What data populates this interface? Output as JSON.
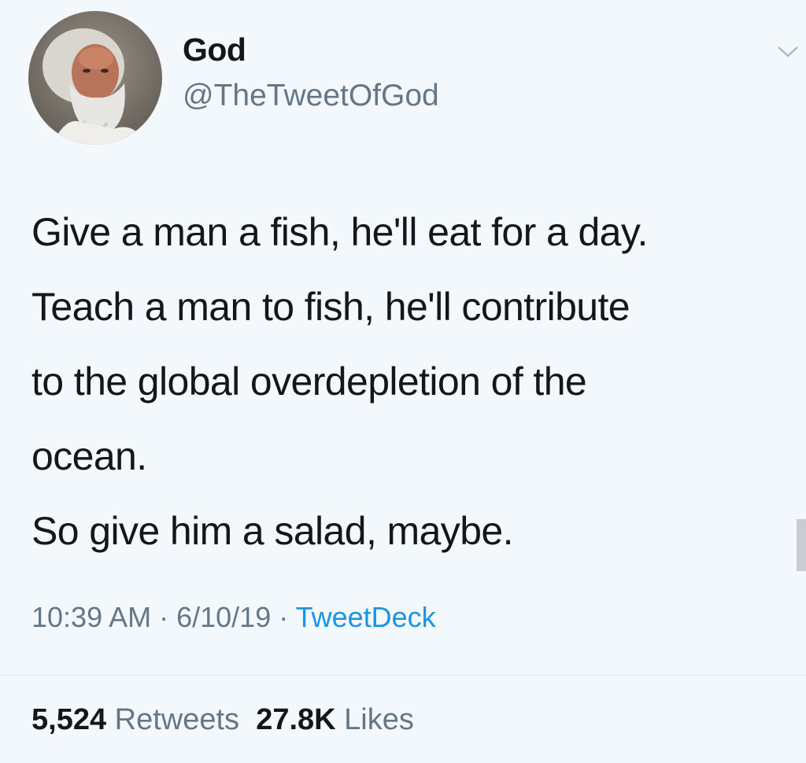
{
  "tweet": {
    "display_name": "God",
    "handle": "@TheTweetOfGod",
    "text_lines": [
      "Give a man a fish, he'll eat for a day.",
      "Teach a man to fish, he'll contribute",
      "to the global overdepletion of the",
      "ocean.",
      "So give him a salad, maybe."
    ],
    "time": "10:39 AM",
    "date": "6/10/19",
    "separator": " · ",
    "source": "TweetDeck",
    "retweets_count": "5,524",
    "retweets_label": "Retweets",
    "likes_count": "27.8K",
    "likes_label": "Likes"
  },
  "icons": {
    "menu": "chevron-down-icon",
    "avatar": "avatar"
  },
  "colors": {
    "background": "#f3f8fc",
    "text": "#14171a",
    "secondary": "#657786",
    "link": "#1b95e0"
  }
}
